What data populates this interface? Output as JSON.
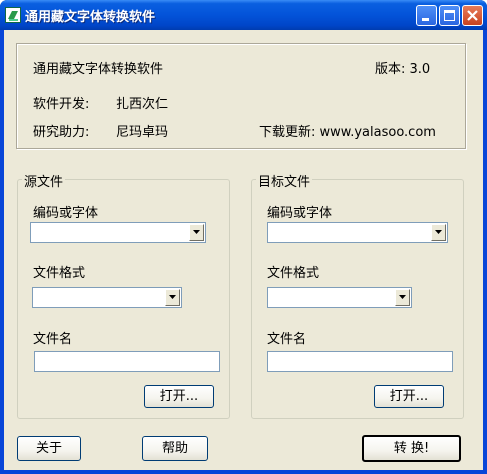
{
  "window": {
    "title": "通用藏文字体转换软件",
    "controls": {
      "minimize_icon": "minimize-icon",
      "maximize_icon": "maximize-icon",
      "close_icon": "close-icon"
    }
  },
  "info": {
    "app_name": "通用藏文字体转换软件",
    "version": "版本: 3.0",
    "developer_label": "软件开发:",
    "developer_name": "扎西次仁",
    "assistant_label": "研究助力:",
    "assistant_name": "尼玛卓玛",
    "download": "下载更新: www.yalasoo.com"
  },
  "source": {
    "legend": "源文件",
    "encoding_label": "编码或字体",
    "encoding_value": "",
    "format_label": "文件格式",
    "format_value": "",
    "filename_label": "文件名",
    "filename_value": "",
    "open_button": "打开..."
  },
  "target": {
    "legend": "目标文件",
    "encoding_label": "编码或字体",
    "encoding_value": "",
    "format_label": "文件格式",
    "format_value": "",
    "filename_label": "文件名",
    "filename_value": "",
    "open_button": "打开..."
  },
  "buttons": {
    "about": "关于",
    "help": "帮助",
    "convert": "转 换!"
  }
}
